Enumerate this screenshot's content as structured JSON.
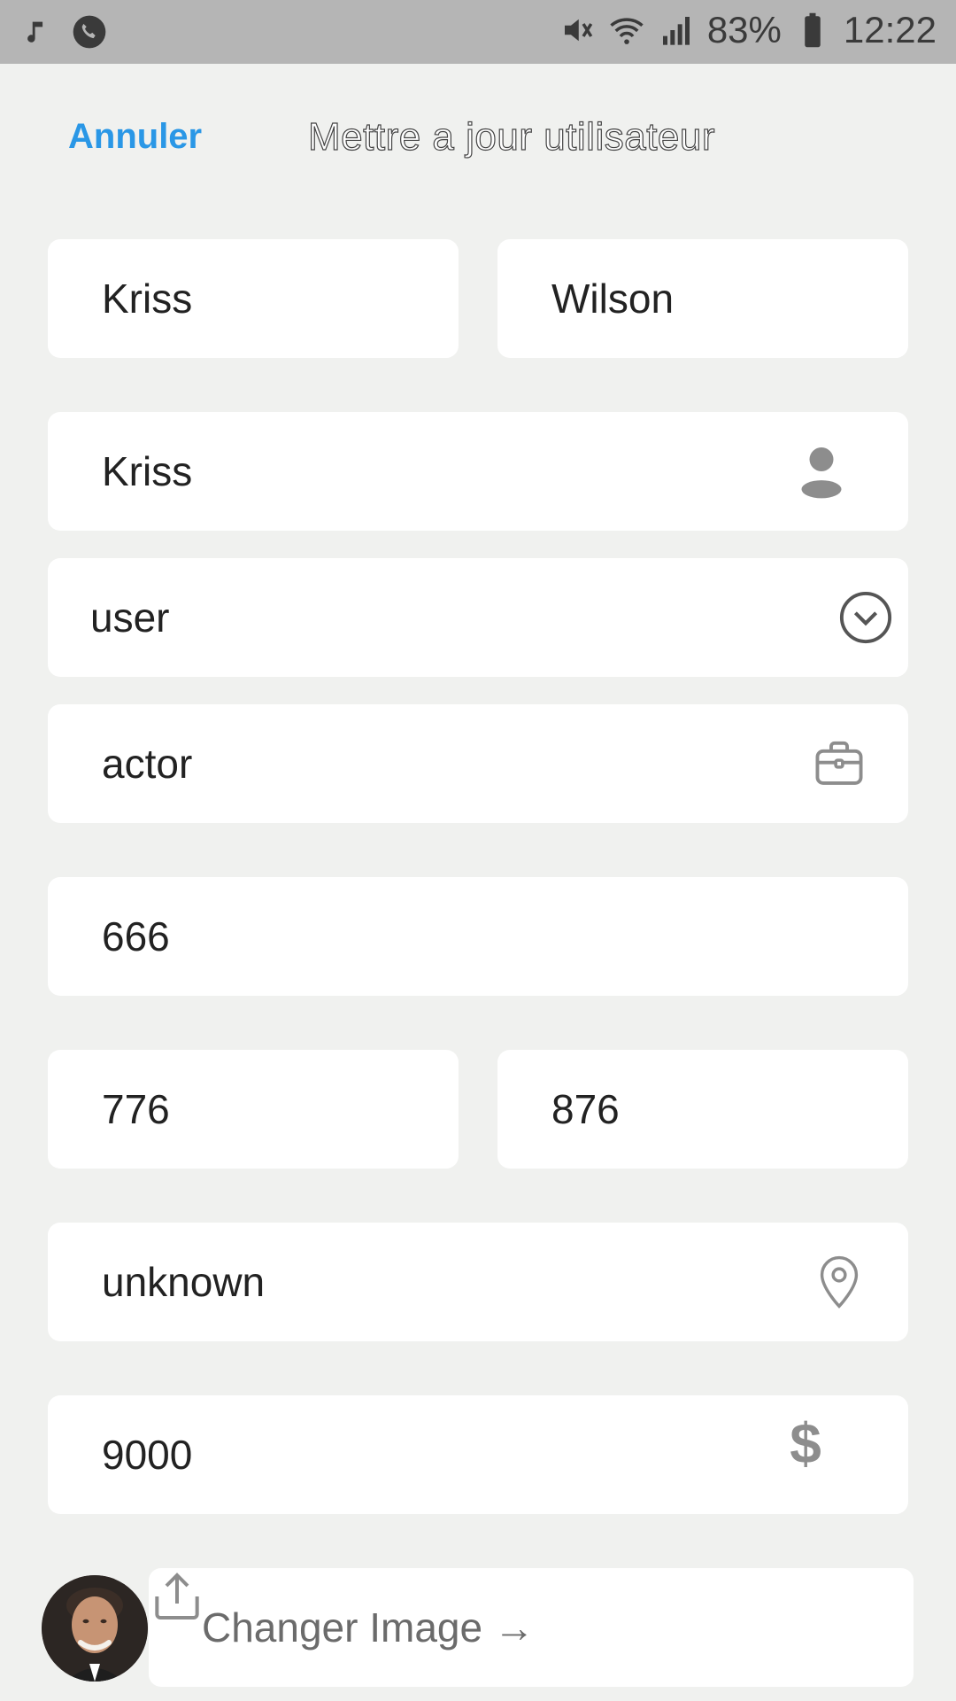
{
  "status_bar": {
    "battery": "83%",
    "time": "12:22",
    "icons_left": [
      "music-note-icon",
      "phone-icon"
    ],
    "icons_right": [
      "mute-icon",
      "wifi-icon",
      "signal-icon",
      "battery-icon"
    ]
  },
  "header": {
    "cancel_label": "Annuler",
    "title": "Mettre a jour utilisateur"
  },
  "form": {
    "first_name": "Kriss",
    "last_name": "Wilson",
    "username": "Kriss",
    "role": "user",
    "profession": "actor",
    "field_a": "666",
    "field_b": "776",
    "field_c": "876",
    "location": "unknown",
    "salary": "9000",
    "change_image_label": "Changer Image →"
  },
  "colors": {
    "accent": "#2a97e6",
    "background": "#f0f1ef",
    "field": "#ffffff",
    "icon": "#8d8d8d"
  }
}
